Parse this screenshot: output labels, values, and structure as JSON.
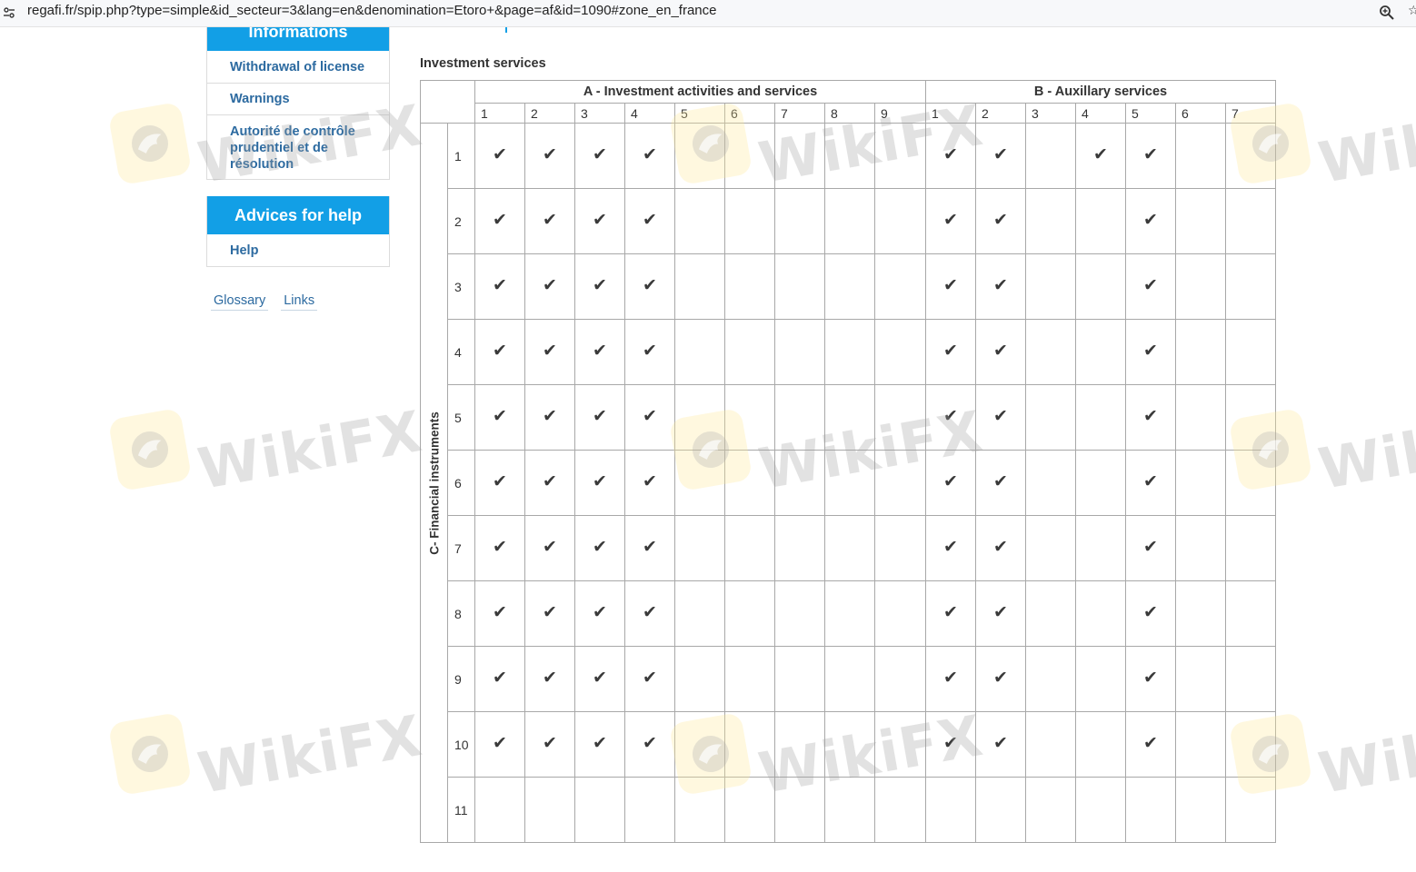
{
  "browser": {
    "url": "regafi.fr/spip.php?type=simple&id_secteur=3&lang=en&denomination=Etoro+&page=af&id=1090#zone_en_france"
  },
  "sidebar": {
    "info_box": {
      "header": "Informations",
      "items": [
        "Withdrawal of license",
        "Warnings",
        "Autorité de contrôle prudentiel et de résolution"
      ]
    },
    "help_box": {
      "header": "Advices for help",
      "items": [
        "Help"
      ]
    },
    "bottom_links": [
      "Glossary",
      "Links"
    ]
  },
  "main": {
    "section_title": "Investment services",
    "table": {
      "group_a": "A - Investment activities and services",
      "group_b": "B - Auxillary services",
      "row_axis_label": "C- Financial instruments",
      "a_columns": [
        "1",
        "2",
        "3",
        "4",
        "5",
        "6",
        "7",
        "8",
        "9"
      ],
      "b_columns": [
        "1",
        "2",
        "3",
        "4",
        "5",
        "6",
        "7"
      ],
      "rows": [
        {
          "label": "1",
          "a": [
            1,
            1,
            1,
            1,
            0,
            0,
            0,
            0,
            0
          ],
          "b": [
            1,
            1,
            0,
            1,
            1,
            0,
            0
          ]
        },
        {
          "label": "2",
          "a": [
            1,
            1,
            1,
            1,
            0,
            0,
            0,
            0,
            0
          ],
          "b": [
            1,
            1,
            0,
            0,
            1,
            0,
            0
          ]
        },
        {
          "label": "3",
          "a": [
            1,
            1,
            1,
            1,
            0,
            0,
            0,
            0,
            0
          ],
          "b": [
            1,
            1,
            0,
            0,
            1,
            0,
            0
          ]
        },
        {
          "label": "4",
          "a": [
            1,
            1,
            1,
            1,
            0,
            0,
            0,
            0,
            0
          ],
          "b": [
            1,
            1,
            0,
            0,
            1,
            0,
            0
          ]
        },
        {
          "label": "5",
          "a": [
            1,
            1,
            1,
            1,
            0,
            0,
            0,
            0,
            0
          ],
          "b": [
            1,
            1,
            0,
            0,
            1,
            0,
            0
          ]
        },
        {
          "label": "6",
          "a": [
            1,
            1,
            1,
            1,
            0,
            0,
            0,
            0,
            0
          ],
          "b": [
            1,
            1,
            0,
            0,
            1,
            0,
            0
          ]
        },
        {
          "label": "7",
          "a": [
            1,
            1,
            1,
            1,
            0,
            0,
            0,
            0,
            0
          ],
          "b": [
            1,
            1,
            0,
            0,
            1,
            0,
            0
          ]
        },
        {
          "label": "8",
          "a": [
            1,
            1,
            1,
            1,
            0,
            0,
            0,
            0,
            0
          ],
          "b": [
            1,
            1,
            0,
            0,
            1,
            0,
            0
          ]
        },
        {
          "label": "9",
          "a": [
            1,
            1,
            1,
            1,
            0,
            0,
            0,
            0,
            0
          ],
          "b": [
            1,
            1,
            0,
            0,
            1,
            0,
            0
          ]
        },
        {
          "label": "10",
          "a": [
            1,
            1,
            1,
            1,
            0,
            0,
            0,
            0,
            0
          ],
          "b": [
            1,
            1,
            0,
            0,
            1,
            0,
            0
          ]
        },
        {
          "label": "11",
          "a": [
            0,
            0,
            0,
            0,
            0,
            0,
            0,
            0,
            0
          ],
          "b": [
            0,
            0,
            0,
            0,
            0,
            0,
            0
          ]
        }
      ],
      "check_glyph": "✔"
    }
  },
  "watermark": {
    "text": "WikiFX",
    "logo_color": "#ffe896"
  },
  "icons": {
    "site_info": "tune-icon",
    "zoom": "zoom-icon",
    "bookmark": "star-icon"
  }
}
